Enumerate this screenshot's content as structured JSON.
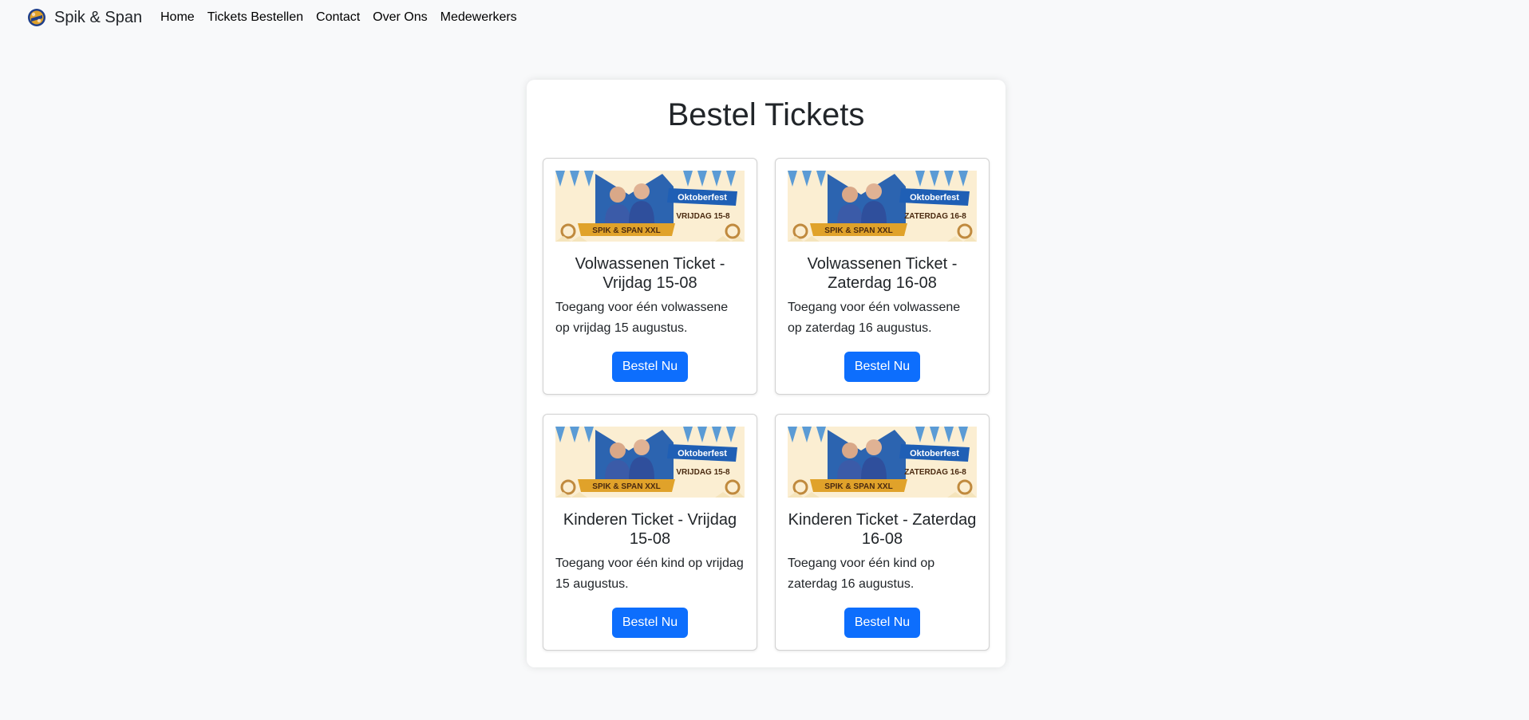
{
  "navbar": {
    "brand": "Spik & Span",
    "links": [
      "Home",
      "Tickets Bestellen",
      "Contact",
      "Over Ons",
      "Medewerkers"
    ]
  },
  "main": {
    "title": "Bestel Tickets",
    "tickets": [
      {
        "title": "Volwassenen Ticket - Vrijdag 15-08",
        "description": "Toegang voor één volwassene op vrijdag 15 augustus.",
        "button": "Bestel Nu",
        "banner": {
          "event": "Oktoberfest",
          "date": "VRIJDAG 15-8",
          "name": "SPIK & SPAN XXL"
        }
      },
      {
        "title": "Volwassenen Ticket - Zaterdag 16-08",
        "description": "Toegang voor één volwassene op zaterdag 16 augustus.",
        "button": "Bestel Nu",
        "banner": {
          "event": "Oktoberfest",
          "date": "ZATERDAG 16-8",
          "name": "SPIK & SPAN XXL"
        }
      },
      {
        "title": "Kinderen Ticket - Vrijdag 15-08",
        "description": "Toegang voor één kind op vrijdag 15 augustus.",
        "button": "Bestel Nu",
        "banner": {
          "event": "Oktoberfest",
          "date": "VRIJDAG 15-8",
          "name": "SPIK & SPAN XXL"
        }
      },
      {
        "title": "Kinderen Ticket - Zaterdag 16-08",
        "description": "Toegang voor één kind op zaterdag 16 augustus.",
        "button": "Bestel Nu",
        "banner": {
          "event": "Oktoberfest",
          "date": "ZATERDAG 16-8",
          "name": "SPIK & SPAN XXL"
        }
      }
    ]
  },
  "colors": {
    "page_background": "#f8f9fa",
    "primary_button": "#0d6efd",
    "banner_background": "#fbeed2",
    "bunting_blue": "#5b9bd5",
    "ribbon_blue": "#1f5fb5",
    "ribbon_gold": "#e0a22a"
  },
  "icons": {
    "brand_logo": "spik-span-logo-icon"
  }
}
